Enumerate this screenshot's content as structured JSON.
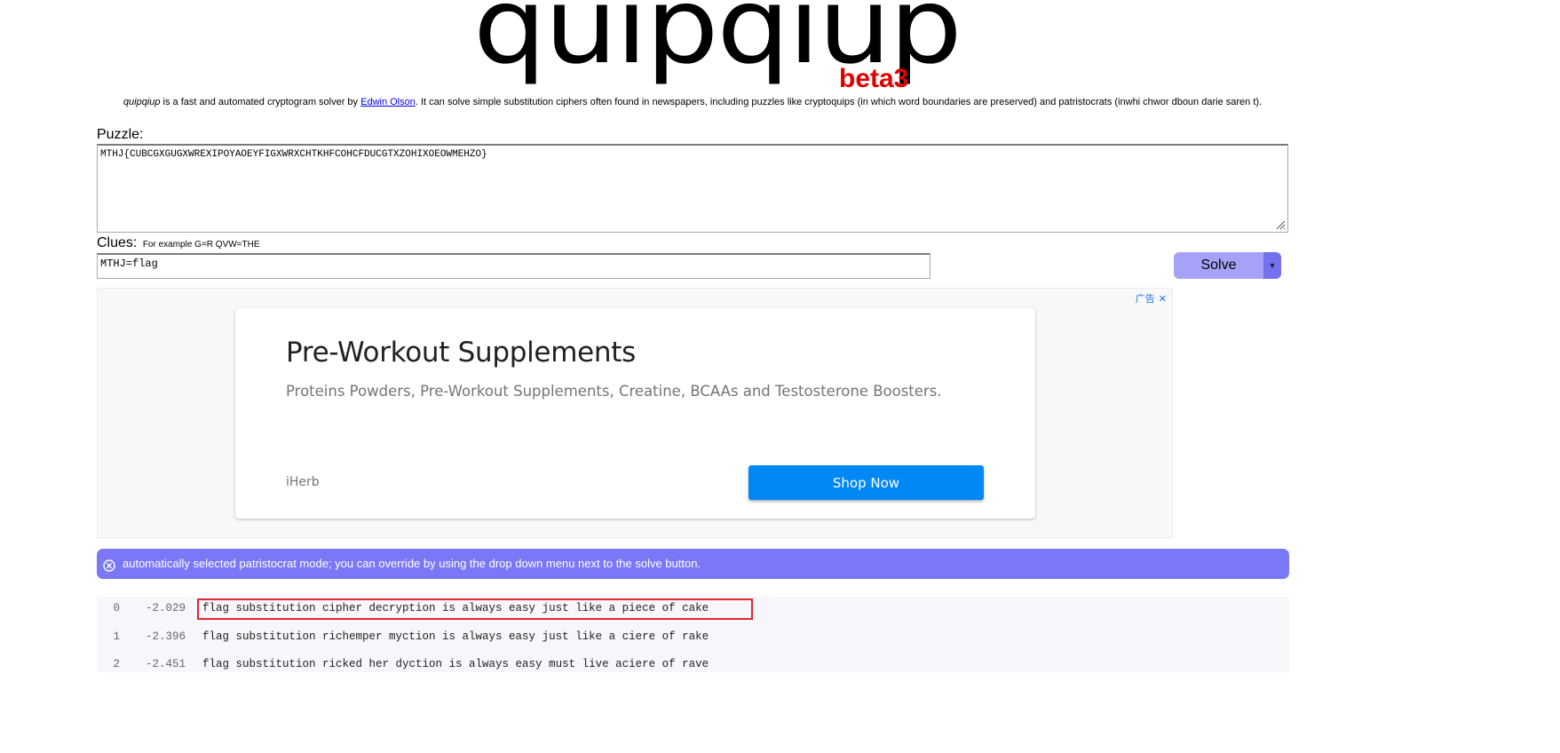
{
  "logo": {
    "word": "quipqiup",
    "beta": "beta3"
  },
  "intro": {
    "app_name": "quipqiup",
    "text_before_link": " is a fast and automated cryptogram solver by ",
    "author_link": "Edwin Olson",
    "text_after_link": ". It can solve simple substitution ciphers often found in newspapers, including puzzles like cryptoquips (in which word boundaries are preserved) and patristocrats (inwhi chwor dboun darie saren t)."
  },
  "puzzle": {
    "label": "Puzzle:",
    "value": "MTHJ{CUBCGXGUGXWREXIPOYAOEYFIGXWRXCHTKHFCOHCFDUCGTXZOHIXOEOWMEHZO}"
  },
  "clues": {
    "label": "Clues:",
    "example": "For example G=R QVW=THE",
    "value": "MTHJ=flag"
  },
  "solve": {
    "label": "Solve",
    "dropdown_glyph": "▼"
  },
  "ad": {
    "choices_label": "广告",
    "close_glyph": "✕",
    "title": "Pre-Workout Supplements",
    "description": "Proteins Powders, Pre-Workout Supplements, Creatine, BCAAs and Testosterone Boosters.",
    "brand": "iHerb",
    "cta": "Shop Now"
  },
  "notice": {
    "text": "automatically selected patristocrat mode; you can override by using the drop down menu next to the solve button."
  },
  "results": [
    {
      "index": "0",
      "score": "-2.029",
      "text": "flag substitution cipher decryption is always easy just like a piece of cake",
      "highlighted": true
    },
    {
      "index": "1",
      "score": "-2.396",
      "text": "flag substitution richemper myction is always easy just like a ciere of rake",
      "highlighted": false
    },
    {
      "index": "2",
      "score": "-2.451",
      "text": "flag substitution ricked her dyction is always easy must live aciere of rave",
      "highlighted": false
    }
  ],
  "colors": {
    "beta_red": "#e00000",
    "solve_button": "#a5a2f7",
    "notice_bg": "#7b78f7",
    "ad_cta": "#0288f5",
    "highlight_border": "#e0262f"
  }
}
